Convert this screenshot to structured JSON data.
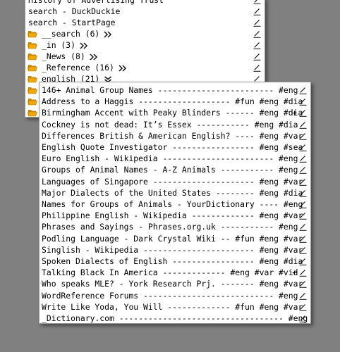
{
  "main_menu": {
    "items": [
      {
        "label": "History of Advertising Trust",
        "folder": false,
        "arrow": ""
      },
      {
        "label": "search - DuckDuckie",
        "folder": false,
        "arrow": ""
      },
      {
        "label": "search - StartPage",
        "folder": false,
        "arrow": ""
      },
      {
        "label": "__search (6)",
        "folder": true,
        "arrow": "right"
      },
      {
        "label": "_in (3)",
        "folder": true,
        "arrow": "right"
      },
      {
        "label": "_News (8)",
        "folder": true,
        "arrow": "right"
      },
      {
        "label": "_Reference (16)",
        "folder": true,
        "arrow": "right"
      },
      {
        "label": "english (21)",
        "folder": true,
        "arrow": "down"
      },
      {
        "label": "",
        "folder": true,
        "arrow": ""
      },
      {
        "label": "",
        "folder": true,
        "arrow": ""
      },
      {
        "label": "",
        "folder": true,
        "arrow": ""
      }
    ]
  },
  "sub_menu": {
    "items": [
      {
        "label": "146+ Animal Group Names ------------------------ #eng",
        "plus": ""
      },
      {
        "label": "Address to a Haggis ------------------- #fun #eng #dia",
        "plus": ""
      },
      {
        "label": "Birmingham Accent with Peaky Blinders ------ #eng #dia",
        "plus": "+"
      },
      {
        "label": "Cockney is not dead: It’s Essex ----------- #eng #dia",
        "plus": ""
      },
      {
        "label": "Differences British & American English? ---- #eng #var",
        "plus": ""
      },
      {
        "label": "English Quote Investigator ----------------- #eng #sea",
        "plus": ""
      },
      {
        "label": "Euro English - Wikipedia ----------------------- #eng",
        "plus": ""
      },
      {
        "label": "Groups of Animal Names - A-Z Animals ----------- #eng",
        "plus": ""
      },
      {
        "label": "Languages of Singapore --------------------- #eng #var",
        "plus": ""
      },
      {
        "label": "Major Dialects of the United States -------- #eng #dia",
        "plus": ""
      },
      {
        "label": "Names for Groups of Animals - YourDictionary ---- #eng",
        "plus": ""
      },
      {
        "label": "Philippine English - Wikipedia ------------- #eng #var",
        "plus": ""
      },
      {
        "label": "Phrases and Sayings - Phrases.org.uk ----------- #eng",
        "plus": ""
      },
      {
        "label": "Podling Language - Dark Crystal Wiki -- #fun #eng #var",
        "plus": ""
      },
      {
        "label": "Singlish - Wikipedia ----------------------- #eng #var",
        "plus": ""
      },
      {
        "label": "Spoken Dialects of English ----------------- #eng #dia",
        "plus": ""
      },
      {
        "label": "Talking Black In America ------------- #eng #var #vid",
        "plus": "+"
      },
      {
        "label": "Who speaks MLE? - York Research Prj. ------- #eng #var",
        "plus": ""
      },
      {
        "label": "WordReference Forums --------------------------- #eng",
        "plus": ""
      },
      {
        "label": "Write Like Yoda, You Will ------------- #fun #eng #var",
        "plus": ""
      },
      {
        "label": "_Dictionary.com ---------------------------------- #eng",
        "plus": ""
      }
    ]
  },
  "icons": {
    "folder": "folder-icon",
    "edit": "pencil-edit-icon",
    "expand_right": "double-chevron-right-icon",
    "expand_down": "double-chevron-down-icon"
  },
  "colors": {
    "background": "#808080",
    "menu_bg": "#ffffff",
    "folder_fill": "#f0a800"
  }
}
